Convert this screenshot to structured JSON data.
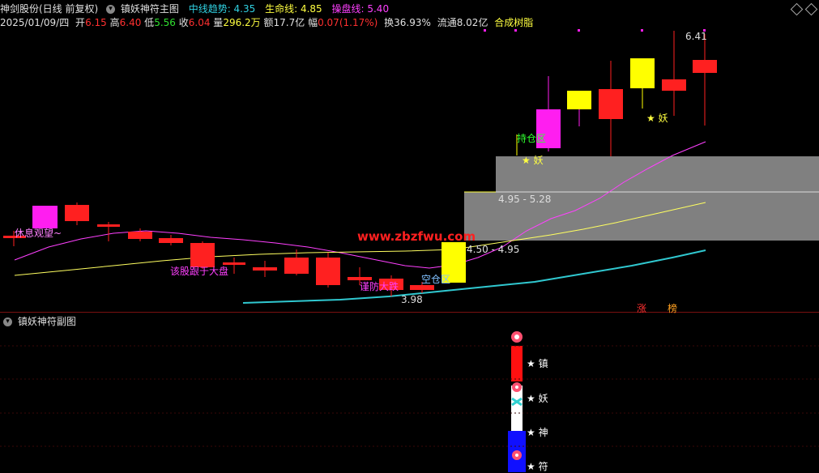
{
  "colors": {
    "up": "#ff2020",
    "down": "#ff2020",
    "magenta": "#ff1ef0",
    "yellow": "#ffff00",
    "cyan": "#30c8d0",
    "trend": "#40d0e0",
    "life": "#ffff40",
    "op": "#ff40ff",
    "gray_zone": "#808080",
    "white": "#ffffff",
    "blue": "#1010ff"
  },
  "header": {
    "title": "神剑股份(日线 前复权)",
    "indicator_name": "镇妖神符主图",
    "trend_label": "中线趋势: 4.35",
    "life_label": "生命线: 4.85",
    "op_label": "操盘线: 5.40",
    "date": "2025/01/09/四",
    "open_label": "开",
    "open": "6.15",
    "high_label": "高",
    "high": "6.40",
    "low_label": "低",
    "low": "5.56",
    "close_label": "收",
    "close": "6.04",
    "vol_label": "量",
    "vol": "296.2万",
    "amt_label": "额",
    "amt": "17.7亿",
    "chg_label": "幅",
    "chg": "0.07(1.17%)",
    "turnover": "换36.93%",
    "float": "流通8.02亿",
    "sector": "合成树脂"
  },
  "annotations": {
    "rest_watch": "休息观望~",
    "follow_market": "该股跟于大盘",
    "watch_zone": "持仓区",
    "empty_zone": "空仓区",
    "defend": "谨防大跌",
    "low_price": "3.98",
    "high_price": "6.41",
    "zone_top": "4.95 - 5.28",
    "zone_bottom": "4.50 - 4.95",
    "star_yao_1": "★ 妖",
    "star_yao_2": "★ 妖",
    "watermark": "www.zbzfwu.com",
    "zhang": "涨",
    "bang": "榜"
  },
  "sub": {
    "title": "镇妖神符副图",
    "labels": [
      "★ 镇",
      "★ 妖",
      "★ 神",
      "★ 符"
    ]
  }
}
